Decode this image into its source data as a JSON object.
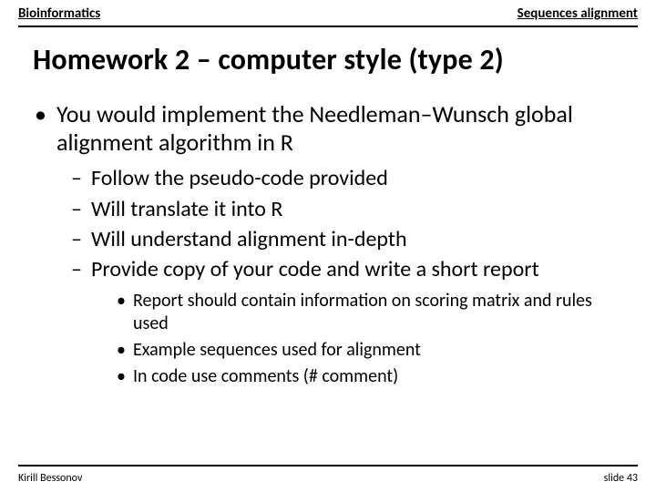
{
  "header": {
    "left": "Bioinformatics",
    "right": "Sequences alignment"
  },
  "title": "Homework 2 – computer style (type 2)",
  "bullets": {
    "lvl1": "You would implement the Needleman–Wunsch global alignment algorithm in R",
    "lvl2": [
      "Follow the pseudo-code provided",
      "Will translate it into R",
      "Will understand alignment in-depth",
      "Provide copy of your code and write a short report"
    ],
    "lvl3": [
      "Report should contain information on scoring matrix and rules used",
      "Example sequences used for alignment",
      "In code use comments (# comment)"
    ]
  },
  "footer": {
    "left": "Kirill Bessonov",
    "right": "slide 43"
  }
}
